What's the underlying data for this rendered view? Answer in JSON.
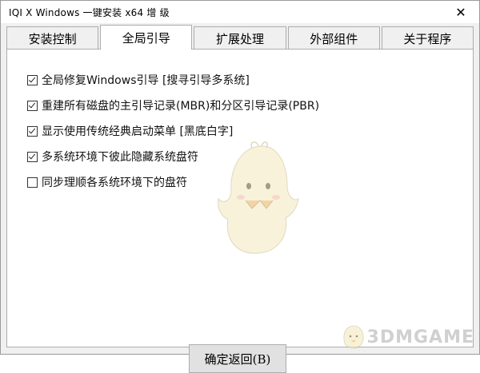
{
  "window": {
    "title": "IQI X Windows 一键安装 x64 增 级",
    "close_glyph": "✕"
  },
  "tabs": [
    {
      "label": "安装控制",
      "active": false
    },
    {
      "label": "全局引导",
      "active": true
    },
    {
      "label": "扩展处理",
      "active": false
    },
    {
      "label": "外部组件",
      "active": false
    },
    {
      "label": "关于程序",
      "active": false
    }
  ],
  "options": [
    {
      "label": "全局修复Windows引导 [搜寻引导多系统]",
      "checked": true
    },
    {
      "label": "重建所有磁盘的主引导记录(MBR)和分区引导记录(PBR)",
      "checked": true
    },
    {
      "label": "显示使用传统经典启动菜单 [黑底白字]",
      "checked": true
    },
    {
      "label": "多系统环境下彼此隐藏系统盘符",
      "checked": true
    },
    {
      "label": "同步理顺各系统环境下的盘符",
      "checked": false
    }
  ],
  "confirm_button": {
    "label": "确定返回(B)"
  },
  "watermark": {
    "text": "3DMGAME"
  },
  "colors": {
    "window_bg": "#f0f0f0",
    "panel_bg": "#ffffff",
    "border": "#adadad",
    "button_bg": "#e1e1e1",
    "mascot_body": "#f3e8bf"
  }
}
